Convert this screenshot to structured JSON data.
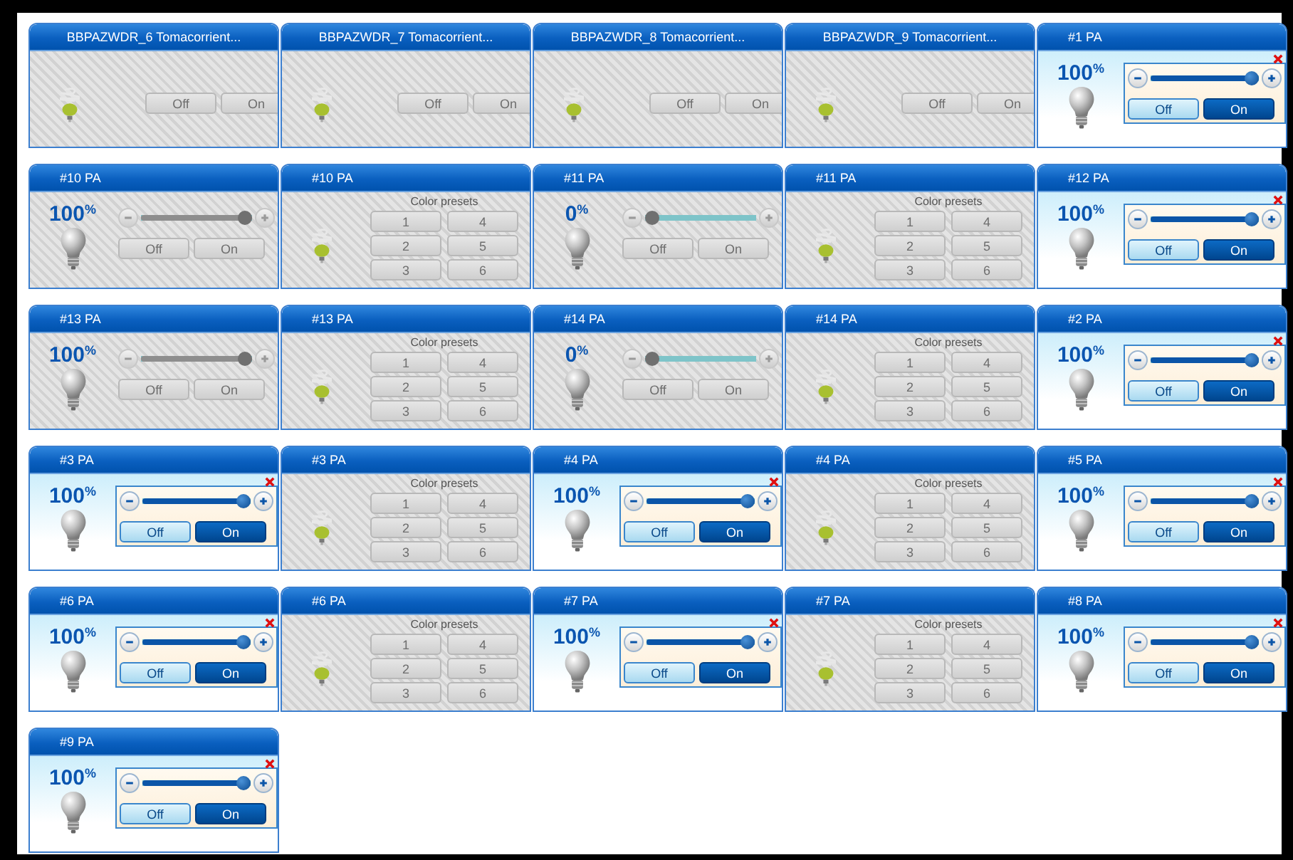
{
  "tiles": [
    {
      "kind": "switch",
      "title": "BBPAZWDR_6 Tomacorrient...",
      "disabled": true,
      "off_label": "Off",
      "on_label": "On"
    },
    {
      "kind": "switch",
      "title": "BBPAZWDR_7 Tomacorrient...",
      "disabled": true,
      "off_label": "Off",
      "on_label": "On"
    },
    {
      "kind": "switch",
      "title": "BBPAZWDR_8 Tomacorrient...",
      "disabled": true,
      "off_label": "Off",
      "on_label": "On"
    },
    {
      "kind": "switch",
      "title": "BBPAZWDR_9 Tomacorrient...",
      "disabled": true,
      "off_label": "Off",
      "on_label": "On"
    },
    {
      "kind": "dimmer",
      "title": "#1 PA",
      "disabled": false,
      "on": true,
      "percent": "100$^{%}$",
      "level": 1,
      "off_label": "Off",
      "on_label": "On"
    },
    {
      "kind": "dimmer",
      "title": "#10 PA",
      "disabled": true,
      "percent": "100$^{%}$",
      "level": 1,
      "off_label": "Off",
      "on_label": "On"
    },
    {
      "kind": "presets",
      "title": "#10 PA",
      "disabled": true,
      "label": "Color presets",
      "presets": [
        "1",
        "2",
        "3",
        "4",
        "5",
        "6"
      ]
    },
    {
      "kind": "dimmer",
      "title": "#11 PA",
      "disabled": true,
      "percent": "0$^{%}$",
      "level": 0,
      "off_label": "Off",
      "on_label": "On"
    },
    {
      "kind": "presets",
      "title": "#11 PA",
      "disabled": true,
      "label": "Color presets",
      "presets": [
        "1",
        "2",
        "3",
        "4",
        "5",
        "6"
      ]
    },
    {
      "kind": "dimmer",
      "title": "#12 PA",
      "disabled": false,
      "on": true,
      "percent": "100$^{%}$",
      "level": 1,
      "off_label": "Off",
      "on_label": "On"
    },
    {
      "kind": "dimmer",
      "title": "#13 PA",
      "disabled": true,
      "percent": "100$^{%}$",
      "level": 1,
      "off_label": "Off",
      "on_label": "On"
    },
    {
      "kind": "presets",
      "title": "#13 PA",
      "disabled": true,
      "label": "Color presets",
      "presets": [
        "1",
        "2",
        "3",
        "4",
        "5",
        "6"
      ]
    },
    {
      "kind": "dimmer",
      "title": "#14 PA",
      "disabled": true,
      "percent": "0$^{%}$",
      "level": 0,
      "off_label": "Off",
      "on_label": "On"
    },
    {
      "kind": "presets",
      "title": "#14 PA",
      "disabled": true,
      "label": "Color presets",
      "presets": [
        "1",
        "2",
        "3",
        "4",
        "5",
        "6"
      ]
    },
    {
      "kind": "dimmer",
      "title": "#2 PA",
      "disabled": false,
      "on": true,
      "percent": "100$^{%}$",
      "level": 1,
      "off_label": "Off",
      "on_label": "On"
    },
    {
      "kind": "dimmer",
      "title": "#3 PA",
      "disabled": false,
      "on": true,
      "percent": "100$^{%}$",
      "level": 1,
      "off_label": "Off",
      "on_label": "On"
    },
    {
      "kind": "presets",
      "title": "#3 PA",
      "disabled": true,
      "label": "Color presets",
      "presets": [
        "1",
        "2",
        "3",
        "4",
        "5",
        "6"
      ]
    },
    {
      "kind": "dimmer",
      "title": "#4 PA",
      "disabled": false,
      "on": true,
      "percent": "100$^{%}$",
      "level": 1,
      "off_label": "Off",
      "on_label": "On"
    },
    {
      "kind": "presets",
      "title": "#4 PA",
      "disabled": true,
      "label": "Color presets",
      "presets": [
        "1",
        "2",
        "3",
        "4",
        "5",
        "6"
      ]
    },
    {
      "kind": "dimmer",
      "title": "#5 PA",
      "disabled": false,
      "on": true,
      "percent": "100$^{%}$",
      "level": 1,
      "off_label": "Off",
      "on_label": "On"
    },
    {
      "kind": "dimmer",
      "title": "#6 PA",
      "disabled": false,
      "on": true,
      "percent": "100$^{%}$",
      "level": 1,
      "off_label": "Off",
      "on_label": "On"
    },
    {
      "kind": "presets",
      "title": "#6 PA",
      "disabled": true,
      "label": "Color presets",
      "presets": [
        "1",
        "2",
        "3",
        "4",
        "5",
        "6"
      ]
    },
    {
      "kind": "dimmer",
      "title": "#7 PA",
      "disabled": false,
      "on": true,
      "percent": "100$^{%}$",
      "level": 1,
      "off_label": "Off",
      "on_label": "On"
    },
    {
      "kind": "presets",
      "title": "#7 PA",
      "disabled": true,
      "label": "Color presets",
      "presets": [
        "1",
        "2",
        "3",
        "4",
        "5",
        "6"
      ]
    },
    {
      "kind": "dimmer",
      "title": "#8 PA",
      "disabled": false,
      "on": true,
      "percent": "100$^{%}$",
      "level": 1,
      "off_label": "Off",
      "on_label": "On"
    },
    {
      "kind": "dimmer",
      "title": "#9 PA",
      "disabled": false,
      "on": true,
      "percent": "100$^{%}$",
      "level": 1,
      "off_label": "Off",
      "on_label": "On"
    }
  ]
}
